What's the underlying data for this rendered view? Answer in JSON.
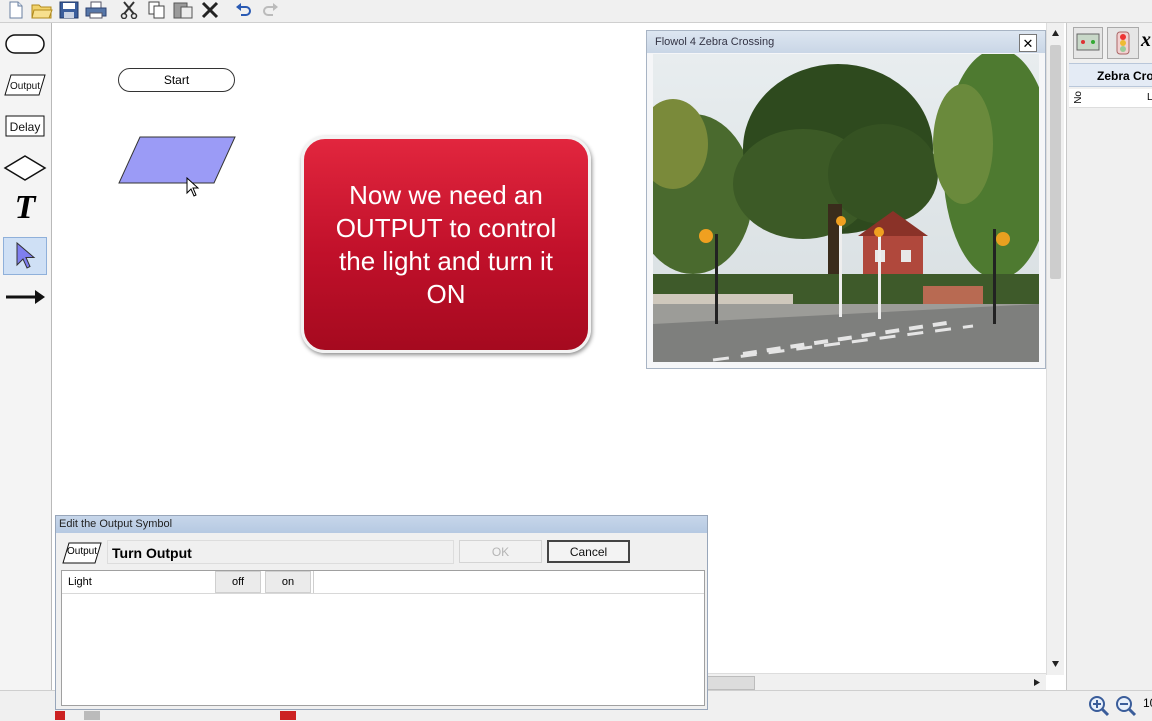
{
  "toolbar": {
    "icons": [
      "new-icon",
      "open-folder-icon",
      "save-icon",
      "print-icon",
      "cut-icon",
      "copy-icon",
      "paste-icon",
      "delete-icon",
      "undo-icon",
      "redo-icon"
    ]
  },
  "palette": {
    "output_label": "Output",
    "delay_label": "Delay",
    "text_tool_label": "T"
  },
  "canvas": {
    "start_label": "Start"
  },
  "callout": {
    "text": "Now we need an\nOUTPUT to control\nthe light and turn it\nON",
    "color": "#c8102e"
  },
  "photo_window": {
    "title": "Flowol 4 Zebra Crossing",
    "close_label": "✕"
  },
  "right_panel": {
    "header": "Zebra Cro",
    "col_a": "No",
    "col_b": "L"
  },
  "status": {
    "zoom": "10"
  },
  "dialog": {
    "title": "Edit the Output Symbol",
    "symbol_label": "Output",
    "name": "Turn Output",
    "ok_label": "OK",
    "cancel_label": "Cancel",
    "rows": [
      {
        "label": "Light",
        "off_label": "off",
        "on_label": "on"
      }
    ]
  }
}
